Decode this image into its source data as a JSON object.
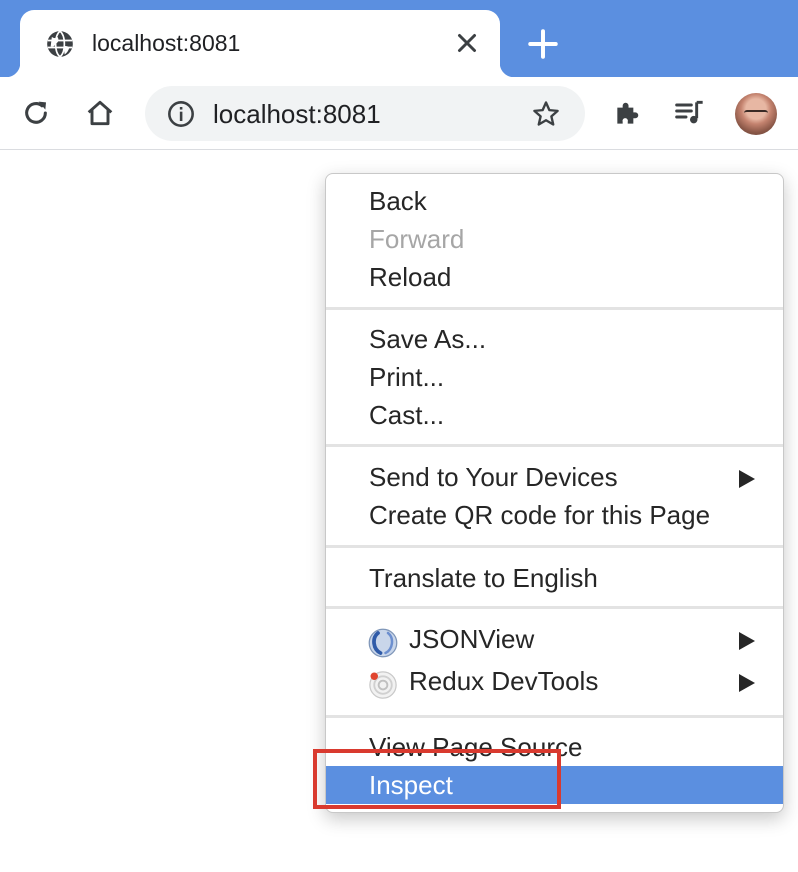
{
  "browser": {
    "tab": {
      "title": "localhost:8081"
    },
    "toolbar": {
      "url": "localhost:8081"
    },
    "colors": {
      "tabstrip": "#5b8fe0",
      "selection": "#5b8fe0",
      "annotation": "#d93a2f"
    }
  },
  "context_menu": {
    "groups": [
      [
        {
          "label": "Back",
          "enabled": true
        },
        {
          "label": "Forward",
          "enabled": false
        },
        {
          "label": "Reload",
          "enabled": true
        }
      ],
      [
        {
          "label": "Save As...",
          "enabled": true
        },
        {
          "label": "Print...",
          "enabled": true
        },
        {
          "label": "Cast...",
          "enabled": true
        }
      ],
      [
        {
          "label": "Send to Your Devices",
          "enabled": true,
          "submenu": true
        },
        {
          "label": "Create QR code for this Page",
          "enabled": true
        }
      ],
      [
        {
          "label": "Translate to English",
          "enabled": true
        }
      ],
      [
        {
          "label": "JSONView",
          "enabled": true,
          "submenu": true,
          "icon": "jsonview-icon"
        },
        {
          "label": "Redux DevTools",
          "enabled": true,
          "submenu": true,
          "icon": "redux-devtools-icon"
        }
      ],
      [
        {
          "label": "View Page Source",
          "enabled": true
        },
        {
          "label": "Inspect",
          "enabled": true,
          "selected": true
        }
      ]
    ]
  }
}
